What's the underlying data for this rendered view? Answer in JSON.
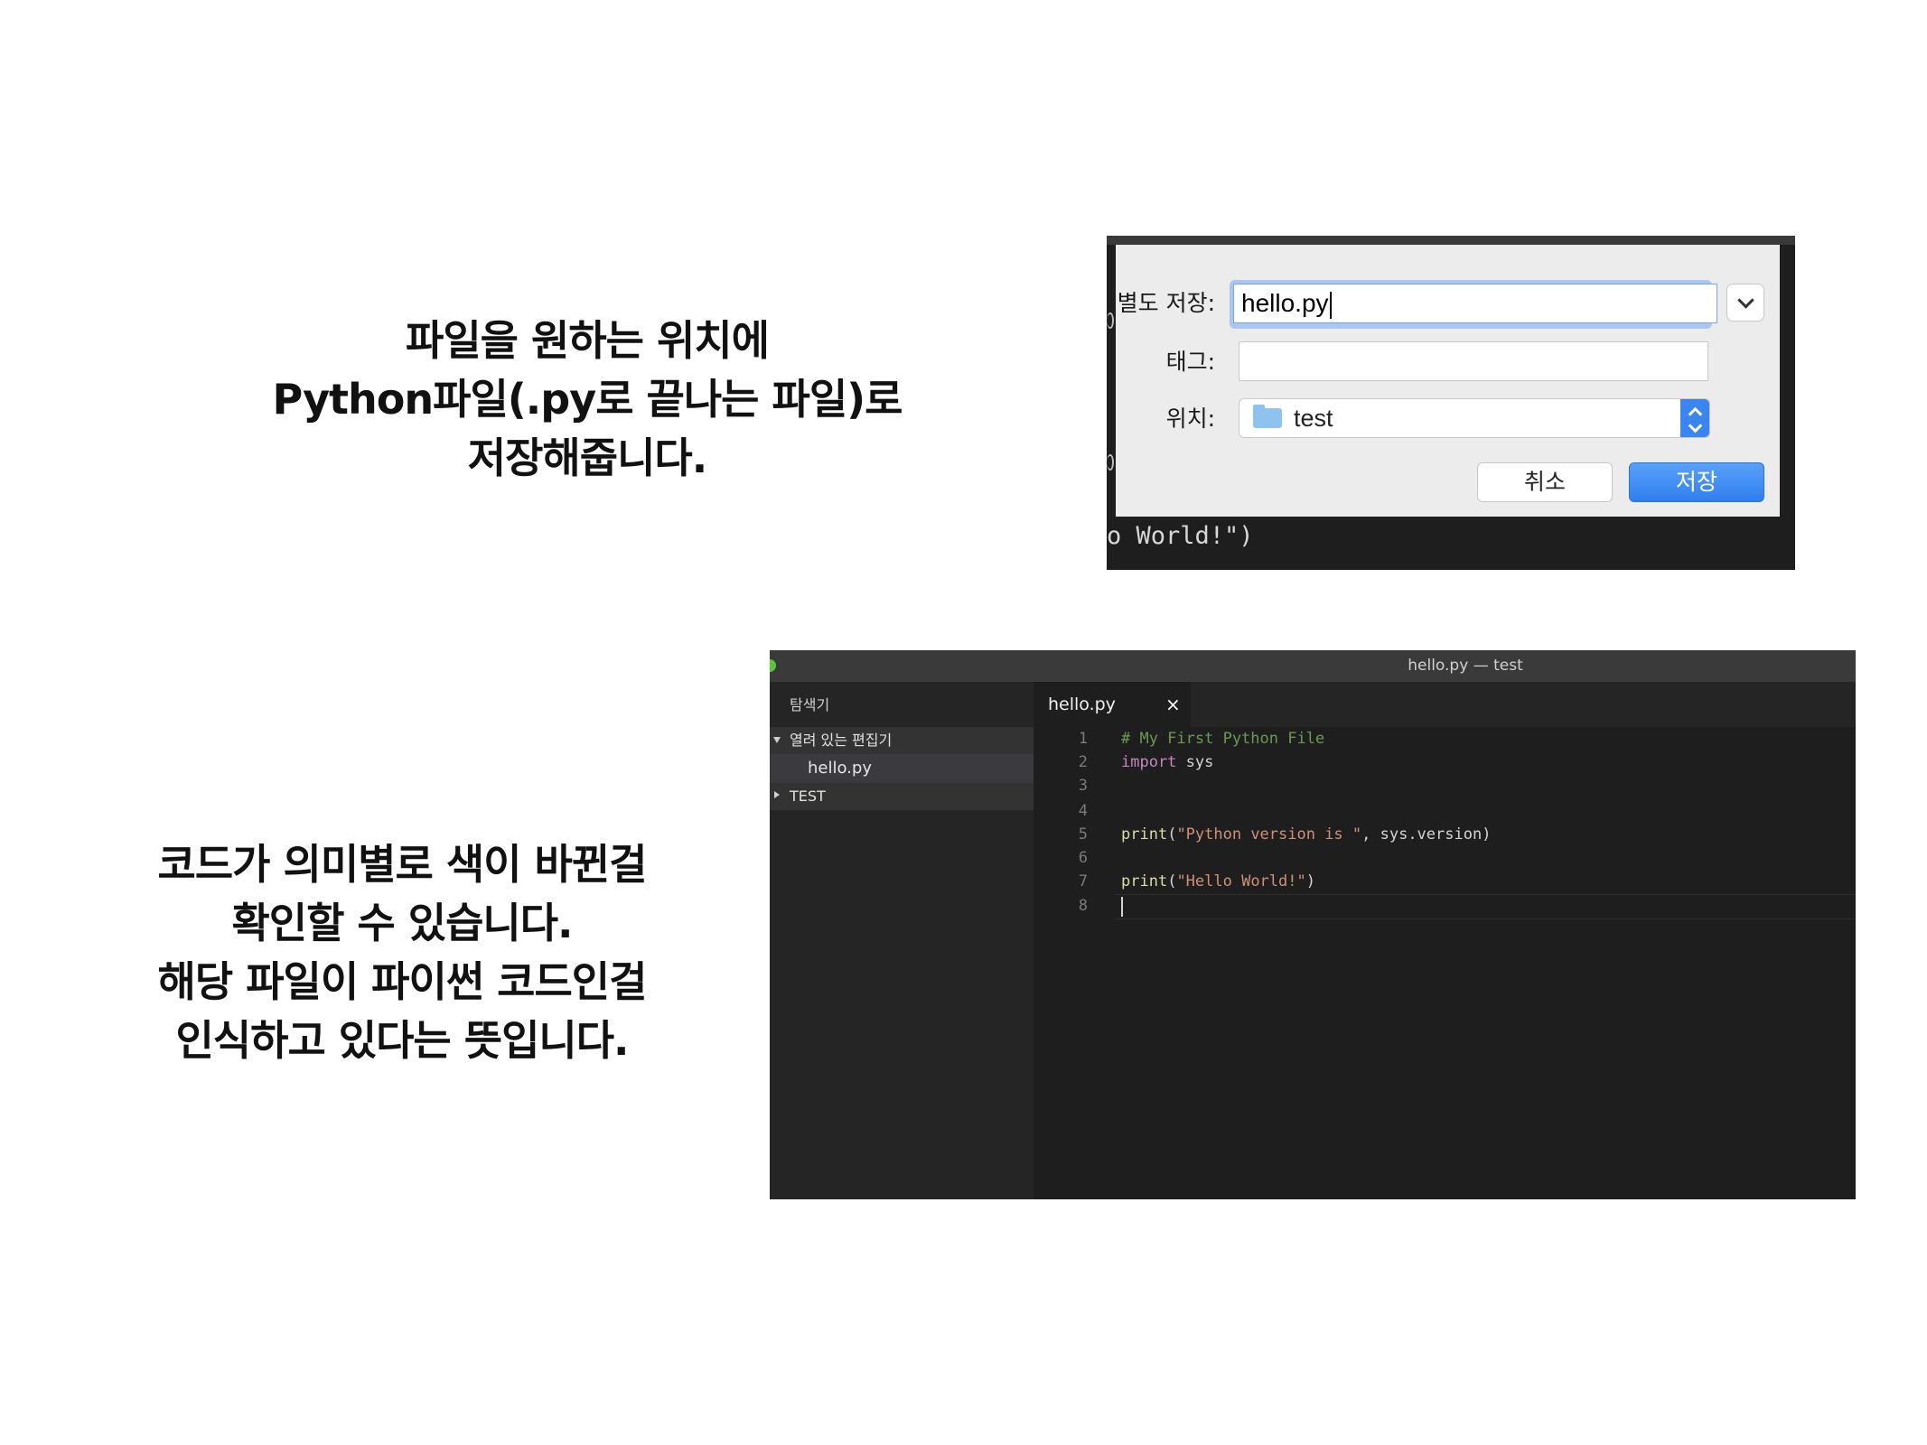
{
  "captions": {
    "top": [
      "파일을 원하는 위치에",
      "Python파일(.py로 끝나는 파일)로",
      "저장해줍니다."
    ],
    "bottom": [
      "코드가 의미별로 색이 바뀐걸",
      "확인할 수 있습니다.",
      "해당 파일이 파이썬 코드인걸",
      "인식하고 있다는 뜻입니다."
    ]
  },
  "save_dialog": {
    "save_as_label": "별도 저장:",
    "filename_value": "hello.py",
    "tags_label": "태그:",
    "tags_value": "",
    "where_label": "위치:",
    "where_value": "test",
    "cancel_label": "취소",
    "save_label": "저장",
    "background_code": "o World!\")",
    "accent_color": "#3a85f0"
  },
  "editor": {
    "window_title": "hello.py — test",
    "explorer_title": "탐색기",
    "open_editors_label": "열려 있는 편집기",
    "open_file": "hello.py",
    "folder_label": "TEST",
    "tab_label": "hello.py",
    "tab_close": "×",
    "line_numbers": [
      "1",
      "2",
      "3",
      "4",
      "5",
      "6",
      "7",
      "8"
    ],
    "code": {
      "l1_comment": "# My First Python File",
      "l2_kw": "import",
      "l2_rest": " sys",
      "l5_fn": "print",
      "l5_open": "(",
      "l5_str": "\"Python version is \"",
      "l5_rest": ", sys.version)",
      "l7_fn": "print",
      "l7_open": "(",
      "l7_str": "\"Hello World!\"",
      "l7_rest": ")"
    }
  }
}
